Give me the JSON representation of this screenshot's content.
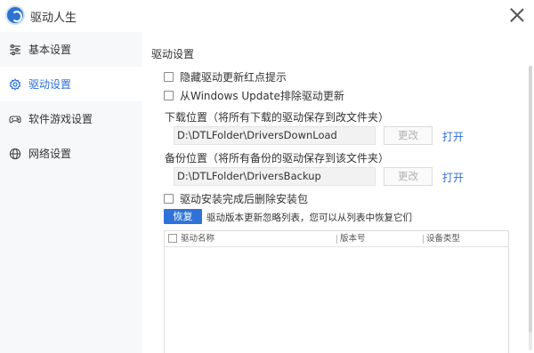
{
  "app": {
    "title": "驱动人生"
  },
  "sidebar": {
    "items": [
      {
        "label": "基本设置",
        "icon": "sliders-icon",
        "active": false
      },
      {
        "label": "驱动设置",
        "icon": "gear-icon",
        "active": true
      },
      {
        "label": "软件游戏设置",
        "icon": "gamepad-icon",
        "active": false
      },
      {
        "label": "网络设置",
        "icon": "globe-icon",
        "active": false
      }
    ]
  },
  "driver_settings": {
    "section_title": "驱动设置",
    "hide_red_dot_label": "隐藏驱动更新红点提示",
    "exclude_windows_update_label": "从Windows Update排除驱动更新",
    "download_location_label": "下载位置（将所有下载的驱动保存到改文件夹）",
    "download_path": "D:\\DTLFolder\\DriversDownLoad",
    "backup_location_label": "备份位置（将所有备份的驱动保存到该文件夹）",
    "backup_path": "D:\\DTLFolder\\DriversBackup",
    "change_label": "更改",
    "open_label": "打开",
    "delete_after_install_label": "驱动安装完成后删除安装包",
    "restore_label": "恢复",
    "restore_hint": "驱动版本更新忽略列表，您可以从列表中恢复它们",
    "table": {
      "columns": [
        "驱动名称",
        "版本号",
        "设备类型"
      ],
      "rows": []
    }
  },
  "colors": {
    "accent": "#2f73d9",
    "link": "#2f6fd6",
    "sidebar_bg": "#f7f8fa"
  }
}
